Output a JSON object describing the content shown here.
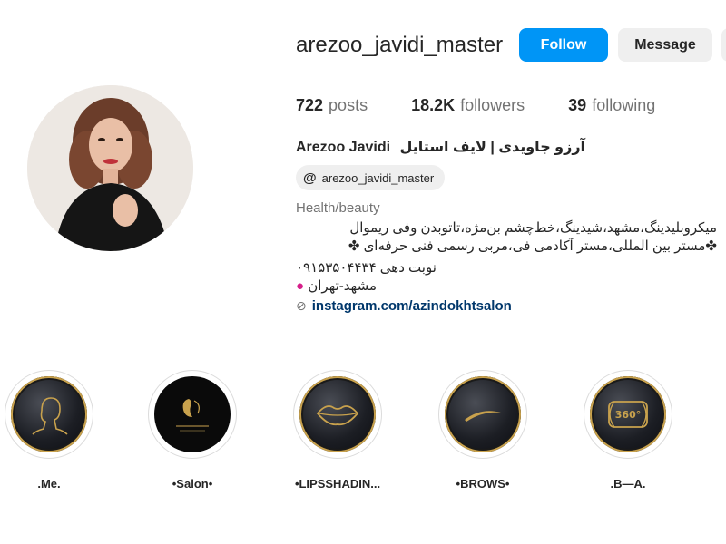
{
  "profile": {
    "username": "arezoo_javidi_master",
    "follow_label": "Follow",
    "message_label": "Message",
    "stats": {
      "posts_count": "722",
      "posts_label": "posts",
      "followers_count": "18.2K",
      "followers_label": "followers",
      "following_count": "39",
      "following_label": "following"
    },
    "full_name_en": "Arezoo Javidi",
    "full_name_fa": "آرزو جاویدی | لایف استایل",
    "threads_handle": "arezoo_javidi_master",
    "category": "Health/beauty",
    "bio_line1": "میکروبلیدینگ،مشهد،شیدینگ،خط‌چشم بن‌مژه،تاتوبدن وفی ریموال",
    "bio_line2": "✤مستر بین المللی،مستر آکادمی فی،مربی رسمی فنی حرفه‌ای ✤",
    "bio_line3": "نوبت دهی ۰۹۱۵۳۵۰۴۴۳۴",
    "bio_line4": "مشهد-تهران",
    "link": "instagram.com/azindokhtsalon"
  },
  "highlights": [
    {
      "label": ".Me.",
      "icon": "woman-silhouette-icon"
    },
    {
      "label": "•Salon•",
      "icon": "salon-logo-icon"
    },
    {
      "label": "•LIPSSHADIN...",
      "icon": "lips-icon"
    },
    {
      "label": "•BROWS•",
      "icon": "brow-icon"
    },
    {
      "label": ".B—A.",
      "icon": "360-camera-icon"
    }
  ],
  "colors": {
    "follow_blue": "#0095f6",
    "link_color": "#00376b",
    "gold": "#c9a24d"
  }
}
